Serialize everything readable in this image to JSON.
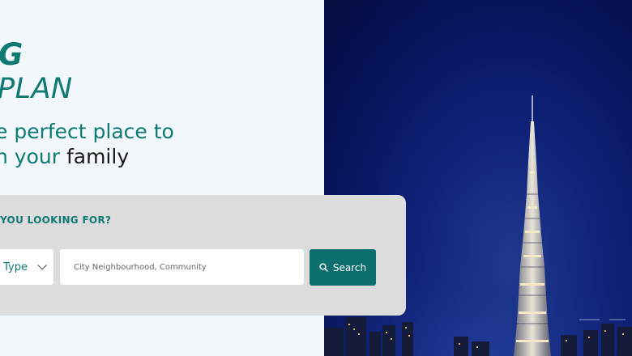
{
  "hero": {
    "line1": "G",
    "line2": "PLAN",
    "tagline_part1": "e perfect place to",
    "tagline_part2": "n your ",
    "tagline_part3": "family"
  },
  "search": {
    "heading": "YOU LOOKING FOR?",
    "type_label": "y Type",
    "location_placeholder": "City Neighbourhood, Community",
    "button_label": "Search"
  },
  "colors": {
    "brand_teal": "#0f7a72",
    "button": "#0d6e6e",
    "night_sky": "#0b1f6e"
  }
}
